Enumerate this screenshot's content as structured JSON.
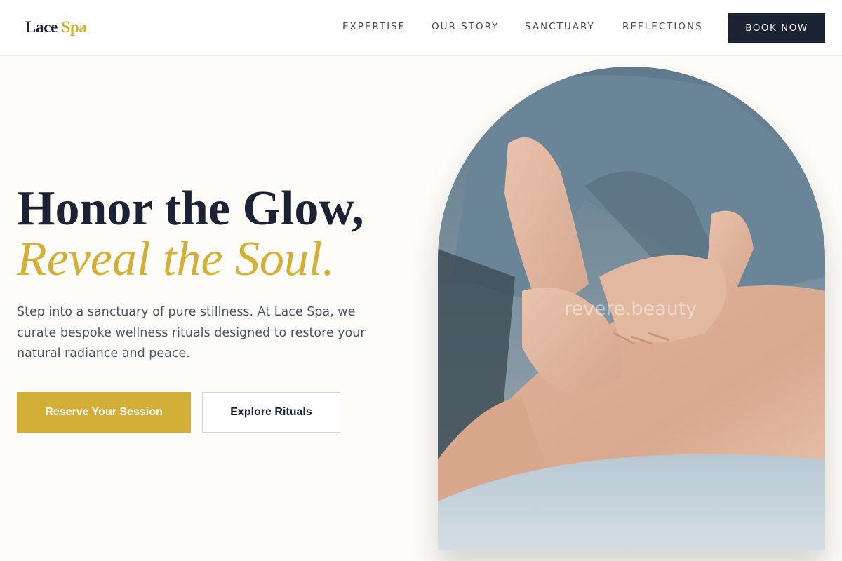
{
  "brand": {
    "name": "Lace",
    "accent": "Spa"
  },
  "nav": {
    "items": [
      "EXPERTISE",
      "OUR STORY",
      "SANCTUARY",
      "REFLECTIONS"
    ],
    "cta_label": "BOOK NOW"
  },
  "hero": {
    "headline": "Honor the Glow,",
    "headline_accent": "Reveal the Soul.",
    "intro": "Step into a sanctuary of pure stillness. At Lace Spa, we curate bespoke wellness rituals designed to restore your natural radiance and peace.",
    "primary_button": "Reserve Your Session",
    "secondary_button": "Explore Rituals"
  },
  "image": {
    "subject": "massage-photo",
    "watermark": "revere.beauty"
  },
  "colors": {
    "navy": "#1b2233",
    "gold": "#d4af37",
    "background": "#fdfcf8",
    "body_text": "#4b5563"
  }
}
